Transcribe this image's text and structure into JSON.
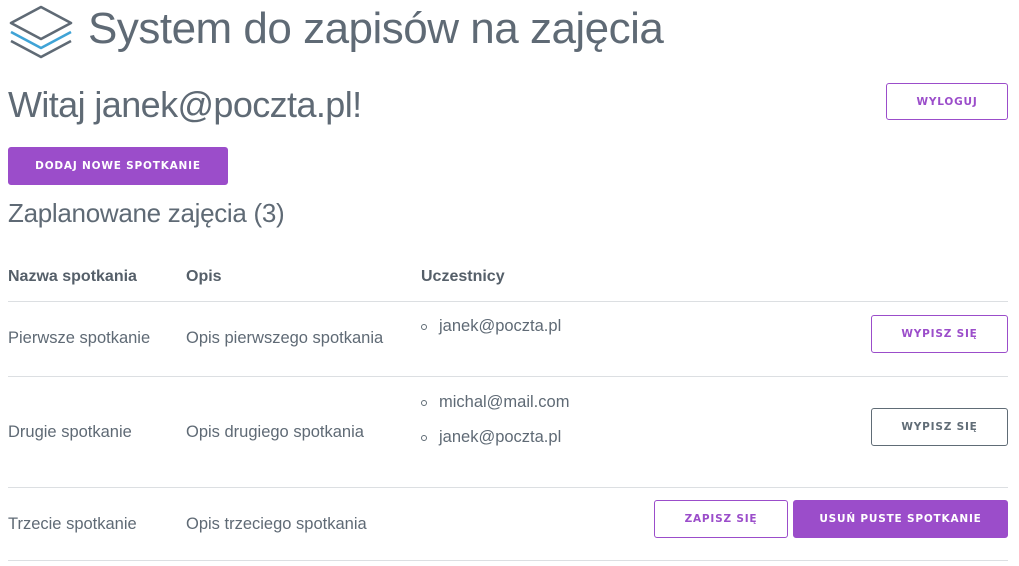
{
  "header": {
    "title": "System do zapisów na zajęcia",
    "logo_icon": "layers-icon"
  },
  "welcome": "Witaj janek@poczta.pl!",
  "buttons": {
    "logout": "WYLOGUJ",
    "add_meeting": "DODAJ NOWE SPOTKANIE"
  },
  "section_title": "Zaplanowane zajęcia (3)",
  "table": {
    "headers": [
      "Nazwa spotkania",
      "Opis",
      "Uczestnicy"
    ],
    "rows": [
      {
        "name": "Pierwsze spotkanie",
        "description": "Opis pierwszego spotkania",
        "participants": [
          "janek@poczta.pl"
        ],
        "actions": [
          "WYPISZ SIĘ"
        ]
      },
      {
        "name": "Drugie spotkanie",
        "description": "Opis drugiego spotkania",
        "participants": [
          "michal@mail.com",
          "janek@poczta.pl"
        ],
        "actions": [
          "WYPISZ SIĘ"
        ]
      },
      {
        "name": "Trzecie spotkanie",
        "description": "Opis trzeciego spotkania",
        "participants": [],
        "actions": [
          "ZAPISZ SIĘ",
          "USUŃ PUSTE SPOTKANIE"
        ]
      }
    ]
  },
  "colors": {
    "accent": "#9b4dca",
    "text": "#606c76",
    "logo_blue": "#3fa3d6"
  }
}
